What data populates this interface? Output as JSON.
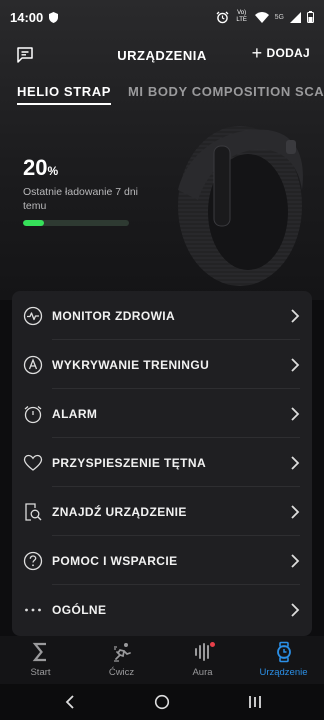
{
  "status_bar": {
    "time": "14:00",
    "network": "Vo) LTE",
    "signal_label": "5G"
  },
  "header": {
    "title": "URZĄDZENIA",
    "add_label": "DODAJ"
  },
  "tabs": [
    {
      "label": "HELIO STRAP",
      "active": true
    },
    {
      "label": "MI BODY COMPOSITION SCALE",
      "active": false
    }
  ],
  "device": {
    "battery_value": "20",
    "battery_unit": "%",
    "battery_fraction": 0.2,
    "last_charged": "Ostatnie ładowanie 7 dni temu"
  },
  "menu": [
    {
      "label": "MONITOR ZDROWIA",
      "icon": "health-monitor-icon"
    },
    {
      "label": "WYKRYWANIE TRENINGU",
      "icon": "workout-detection-icon"
    },
    {
      "label": "ALARM",
      "icon": "alarm-icon"
    },
    {
      "label": "PRZYSPIESZENIE TĘTNA",
      "icon": "heart-icon"
    },
    {
      "label": "ZNAJDŹ URZĄDZENIE",
      "icon": "find-device-icon"
    },
    {
      "label": "POMOC I WSPARCIE",
      "icon": "help-icon"
    },
    {
      "label": "OGÓLNE",
      "icon": "more-icon"
    }
  ],
  "bottom_nav": [
    {
      "label": "Start",
      "icon": "sigma-icon",
      "active": false
    },
    {
      "label": "Ćwicz",
      "icon": "runner-icon",
      "active": false
    },
    {
      "label": "Aura",
      "icon": "aura-icon",
      "active": false,
      "badge": true
    },
    {
      "label": "Urządzenie",
      "icon": "watch-icon",
      "active": true
    }
  ],
  "colors": {
    "accent": "#2b8fe6",
    "battery_fill": "#36e05a",
    "badge": "#e8404a"
  }
}
